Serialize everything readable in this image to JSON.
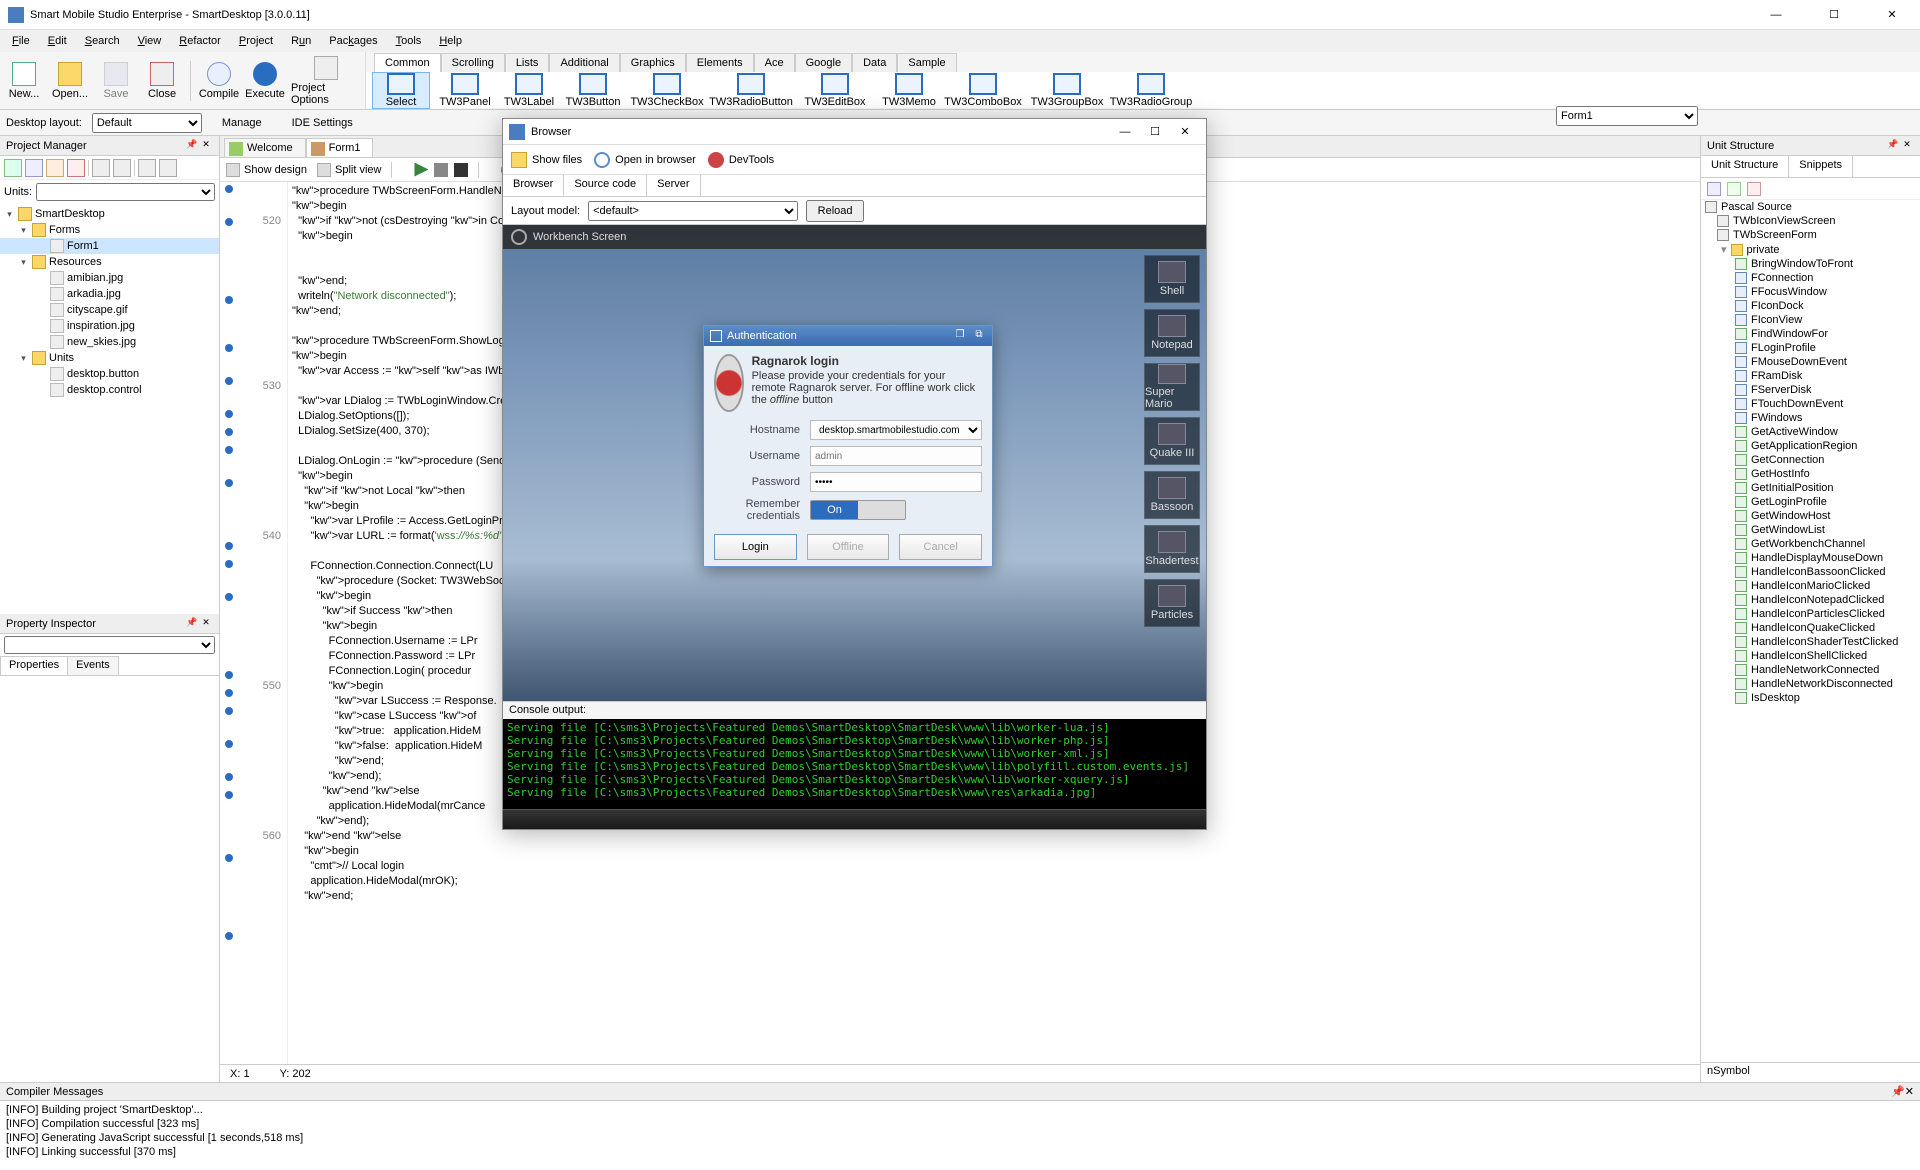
{
  "window": {
    "title": "Smart Mobile Studio Enterprise - SmartDesktop [3.0.0.11]"
  },
  "menu": [
    "File",
    "Edit",
    "Search",
    "View",
    "Refactor",
    "Project",
    "Run",
    "Packages",
    "Tools",
    "Help"
  ],
  "toolbar": {
    "new": "New...",
    "open": "Open...",
    "save": "Save",
    "close": "Close",
    "compile": "Compile",
    "execute": "Execute",
    "options": "Project Options"
  },
  "layout": {
    "label": "Desktop layout:",
    "value": "Default",
    "manage": "Manage",
    "ide": "IDE Settings"
  },
  "palette_tabs": [
    "Common",
    "Scrolling",
    "Lists",
    "Additional",
    "Graphics",
    "Elements",
    "Ace",
    "Google",
    "Data",
    "Sample"
  ],
  "palette": [
    "Select",
    "TW3Panel",
    "TW3Label",
    "TW3Button",
    "TW3CheckBox",
    "TW3RadioButton",
    "TW3EditBox",
    "TW3Memo",
    "TW3ComboBox",
    "TW3GroupBox",
    "TW3RadioGroup"
  ],
  "pm": {
    "title": "Project Manager",
    "units_label": "Units:",
    "tree": {
      "root": "SmartDesktop",
      "forms": "Forms",
      "form1": "Form1",
      "resources": "Resources",
      "res": [
        "amibian.jpg",
        "arkadia.jpg",
        "cityscape.gif",
        "inspiration.jpg",
        "new_skies.jpg"
      ],
      "units": "Units",
      "unit_items": [
        "desktop.button",
        "desktop.control"
      ]
    }
  },
  "pi": {
    "title": "Property Inspector",
    "tabs": [
      "Properties",
      "Events"
    ]
  },
  "docs": {
    "welcome": "Welcome",
    "form1": "Form1"
  },
  "viewbar": {
    "show": "Show design",
    "split": "Split view"
  },
  "status_code": {
    "x": "X: 1",
    "y": "Y: 202"
  },
  "form_selector": "Form1",
  "unit_structure": {
    "title": "Unit Structure",
    "tabs": [
      "Unit Structure",
      "Snippets"
    ],
    "root": "Pascal Source",
    "classes": [
      "TWbIconViewScreen",
      "TWbScreenForm"
    ],
    "private": "private",
    "members": [
      "BringWindowToFront",
      "FConnection",
      "FFocusWindow",
      "FIconDock",
      "FIconView",
      "FindWindowFor",
      "FLoginProfile",
      "FMouseDownEvent",
      "FRamDisk",
      "FServerDisk",
      "FTouchDownEvent",
      "FWindows",
      "GetActiveWindow",
      "GetApplicationRegion",
      "GetConnection",
      "GetHostInfo",
      "GetInitialPosition",
      "GetLoginProfile",
      "GetWindowHost",
      "GetWindowList",
      "GetWorkbenchChannel",
      "HandleDisplayMouseDown",
      "HandleIconBassoonClicked",
      "HandleIconMarioClicked",
      "HandleIconNotepadClicked",
      "HandleIconParticlesClicked",
      "HandleIconQuakeClicked",
      "HandleIconShaderTestClicked",
      "HandleIconShellClicked",
      "HandleNetworkConnected",
      "HandleNetworkDisconnected",
      "IsDesktop"
    ],
    "nsymbol": "nSymbol"
  },
  "code_gutter": [
    "",
    "",
    "520",
    "",
    "",
    "",
    "",
    "",
    "",
    "",
    "",
    "",
    "",
    "530",
    "",
    "",
    "",
    "",
    "",
    "",
    "",
    "",
    "",
    "540",
    "",
    "",
    "",
    "",
    "",
    "",
    "",
    "",
    "",
    "550",
    "",
    "",
    "",
    "",
    "",
    "",
    "",
    "",
    "",
    "560",
    "",
    "",
    "",
    "",
    "",
    "",
    "",
    "",
    "",
    ""
  ],
  "code_lines": [
    "procedure TWbScreenForm.HandleNetworkDi",
    "begin",
    "  if not (csDestroying in ComponentStat",
    "  begin",
    "",
    "",
    "  end;",
    "  writeln(\"Network disconnected\");",
    "end;",
    "",
    "procedure TWbScreenForm.ShowLoginDialog",
    "begin",
    "  var Access := self as IWbDesktop;",
    "",
    "  var LDialog := TWbLoginWindow.Create(",
    "  LDialog.SetOptions([]);",
    "  LDialog.SetSize(400, 370);",
    "",
    "  LDialog.OnLogin := procedure (Sender:",
    "  begin",
    "    if not Local then",
    "    begin",
    "      var LProfile := Access.GetLoginPr",
    "      var LURL := format('wss://%s:%d',",
    "",
    "      FConnection.Connection.Connect(LU",
    "        procedure (Socket: TW3WebSocket",
    "        begin",
    "          if Success then",
    "          begin",
    "            FConnection.Username := LPr",
    "            FConnection.Password := LPr",
    "            FConnection.Login( procedur",
    "            begin",
    "              var LSuccess := Response.",
    "              case LSuccess of",
    "              true:   application.HideM",
    "              false:  application.HideM",
    "              end;",
    "            end);",
    "          end else",
    "            application.HideModal(mrCance",
    "        end);",
    "    end else",
    "    begin",
    "      // Local login",
    "      application.HideModal(mrOK);",
    "    end;"
  ],
  "compiler": {
    "title": "Compiler Messages",
    "lines": [
      "[INFO] Building project 'SmartDesktop'...",
      "[INFO] Compilation successful [323 ms]",
      "[INFO] Generating JavaScript successful [1 seconds,518 ms]",
      "[INFO] Linking successful [370 ms]"
    ]
  },
  "browser": {
    "title": "Browser",
    "tb": {
      "showfiles": "Show files",
      "openin": "Open in browser",
      "devtools": "DevTools"
    },
    "subtabs": [
      "Browser",
      "Source code",
      "Server"
    ],
    "layout_label": "Layout model:",
    "layout_value": "<default>",
    "reload": "Reload",
    "wb_title": "Workbench Screen",
    "desk_icons": [
      "Shell",
      "Notepad",
      "Super Mario",
      "Quake III",
      "Bassoon",
      "Shadertest",
      "Particles"
    ],
    "auth": {
      "title": "Authentication",
      "heading": "Ragnarok login",
      "desc1": "Please provide your credentials for your remote Ragnarok server. For offline work click the ",
      "desc2": "offline",
      "desc3": " button",
      "hostname_label": "Hostname",
      "hostname_value": "desktop.smartmobilestudio.com",
      "username_label": "Username",
      "username_ph": "admin",
      "password_label": "Password",
      "remember_label": "Remember credentials",
      "toggle_on": "On",
      "btn_login": "Login",
      "btn_offline": "Offline",
      "btn_cancel": "Cancel"
    },
    "console_label": "Console output:",
    "console": [
      "Serving file [C:\\sms3\\Projects\\Featured Demos\\SmartDesktop\\SmartDesk\\www\\lib\\worker-lua.js]",
      "Serving file [C:\\sms3\\Projects\\Featured Demos\\SmartDesktop\\SmartDesk\\www\\lib\\worker-php.js]",
      "Serving file [C:\\sms3\\Projects\\Featured Demos\\SmartDesktop\\SmartDesk\\www\\lib\\worker-xml.js]",
      "Serving file [C:\\sms3\\Projects\\Featured Demos\\SmartDesktop\\SmartDesk\\www\\lib\\polyfill.custom.events.js]",
      "Serving file [C:\\sms3\\Projects\\Featured Demos\\SmartDesktop\\SmartDesk\\www\\lib\\worker-xquery.js]",
      "Serving file [C:\\sms3\\Projects\\Featured Demos\\SmartDesktop\\SmartDesk\\www\\res\\arkadia.jpg]"
    ]
  }
}
